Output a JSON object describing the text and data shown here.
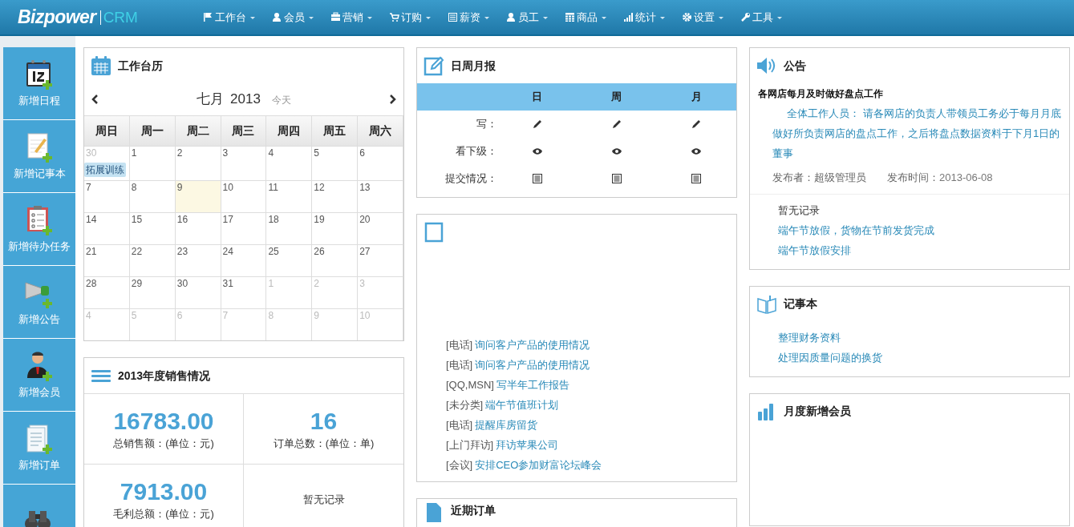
{
  "brand": {
    "logo": "Bizpower",
    "product": "CRM"
  },
  "nav": [
    "工作台",
    "会员",
    "营销",
    "订购",
    "薪资",
    "员工",
    "商品",
    "统计",
    "设置",
    "工具"
  ],
  "sidebar": [
    "新增日程",
    "新增记事本",
    "新增待办任务",
    "新增公告",
    "新增会员",
    "新增订单"
  ],
  "calendar": {
    "title": "工作台历",
    "month": "七月",
    "year": "2013",
    "today_button": "今天",
    "weekdays": [
      "周日",
      "周一",
      "周二",
      "周三",
      "周四",
      "周五",
      "周六"
    ],
    "weeks": [
      [
        {
          "day": "30",
          "other_month": true,
          "selected": false,
          "events": [
            "拓展训练"
          ]
        },
        {
          "day": "1",
          "other_month": false,
          "selected": false
        },
        {
          "day": "2",
          "other_month": false,
          "selected": false
        },
        {
          "day": "3",
          "other_month": false,
          "selected": false
        },
        {
          "day": "4",
          "other_month": false,
          "selected": false
        },
        {
          "day": "5",
          "other_month": false,
          "selected": false
        },
        {
          "day": "6",
          "other_month": false,
          "selected": false
        }
      ],
      [
        {
          "day": "7",
          "other_month": false,
          "selected": false
        },
        {
          "day": "8",
          "other_month": false,
          "selected": false
        },
        {
          "day": "9",
          "other_month": false,
          "selected": true
        },
        {
          "day": "10",
          "other_month": false,
          "selected": false
        },
        {
          "day": "11",
          "other_month": false,
          "selected": false
        },
        {
          "day": "12",
          "other_month": false,
          "selected": false
        },
        {
          "day": "13",
          "other_month": false,
          "selected": false
        }
      ],
      [
        {
          "day": "14",
          "other_month": false,
          "selected": false
        },
        {
          "day": "15",
          "other_month": false,
          "selected": false
        },
        {
          "day": "16",
          "other_month": false,
          "selected": false
        },
        {
          "day": "17",
          "other_month": false,
          "selected": false
        },
        {
          "day": "18",
          "other_month": false,
          "selected": false
        },
        {
          "day": "19",
          "other_month": false,
          "selected": false
        },
        {
          "day": "20",
          "other_month": false,
          "selected": false
        }
      ],
      [
        {
          "day": "21",
          "other_month": false,
          "selected": false
        },
        {
          "day": "22",
          "other_month": false,
          "selected": false
        },
        {
          "day": "23",
          "other_month": false,
          "selected": false
        },
        {
          "day": "24",
          "other_month": false,
          "selected": false
        },
        {
          "day": "25",
          "other_month": false,
          "selected": false
        },
        {
          "day": "26",
          "other_month": false,
          "selected": false
        },
        {
          "day": "27",
          "other_month": false,
          "selected": false
        }
      ],
      [
        {
          "day": "28",
          "other_month": false,
          "selected": false
        },
        {
          "day": "29",
          "other_month": false,
          "selected": false
        },
        {
          "day": "30",
          "other_month": false,
          "selected": false
        },
        {
          "day": "31",
          "other_month": false,
          "selected": false
        },
        {
          "day": "1",
          "other_month": true,
          "selected": false
        },
        {
          "day": "2",
          "other_month": true,
          "selected": false
        },
        {
          "day": "3",
          "other_month": true,
          "selected": false
        }
      ],
      [
        {
          "day": "4",
          "other_month": true,
          "selected": false
        },
        {
          "day": "5",
          "other_month": true,
          "selected": false
        },
        {
          "day": "6",
          "other_month": true,
          "selected": false
        },
        {
          "day": "7",
          "other_month": true,
          "selected": false
        },
        {
          "day": "8",
          "other_month": true,
          "selected": false
        },
        {
          "day": "9",
          "other_month": true,
          "selected": false
        },
        {
          "day": "10",
          "other_month": true,
          "selected": false
        }
      ]
    ]
  },
  "sales": {
    "title": "2013年度销售情况",
    "stats": [
      {
        "kind": "figure",
        "value": "16783.00",
        "label": "总销售额：(单位：元)"
      },
      {
        "kind": "figure",
        "value": "16",
        "label": "订单总数：(单位：单)"
      },
      {
        "kind": "figure",
        "value": "7913.00",
        "label": "毛利总额：(单位：元)"
      },
      {
        "kind": "empty",
        "label": "暂无记录"
      }
    ]
  },
  "reports": {
    "title": "日周月报",
    "columns": [
      "日",
      "周",
      "月"
    ],
    "rows": [
      "写：",
      "看下级：",
      "提交情况："
    ]
  },
  "tasks": {
    "items": [
      {
        "category": "[电话]",
        "text": "询问客户产品的使用情况"
      },
      {
        "category": "[电话]",
        "text": "询问客户产品的使用情况"
      },
      {
        "category": "[QQ,MSN]",
        "text": "写半年工作报告"
      },
      {
        "category": "[未分类]",
        "text": "端午节值班计划"
      },
      {
        "category": "[电话]",
        "text": "提醒库房留货"
      },
      {
        "category": "[上门拜访]",
        "text": "拜访苹果公司"
      },
      {
        "category": "[会议]",
        "text": "安排CEO参加财富论坛峰会"
      }
    ]
  },
  "orders": {
    "title": "近期订单"
  },
  "notice": {
    "title": "公告",
    "headline": "各网店每月及时做好盘点工作",
    "body": "全体工作人员： 请各网店的负责人带领员工务必于每月月底做好所负责网店的盘点工作，之后将盘点数据资料于下月1日的董事",
    "publisher": "发布者：超级管理员",
    "time_label": "发布时间：",
    "time": "2013-06-08",
    "empty": "暂无记录",
    "links": [
      "端午节放假，货物在节前发货完成",
      "端午节放假安排"
    ]
  },
  "notepad": {
    "title": "记事本",
    "items": [
      "整理财务资料",
      "处理因质量问题的换货"
    ]
  },
  "member_stats": {
    "title": "月度新增会员"
  }
}
